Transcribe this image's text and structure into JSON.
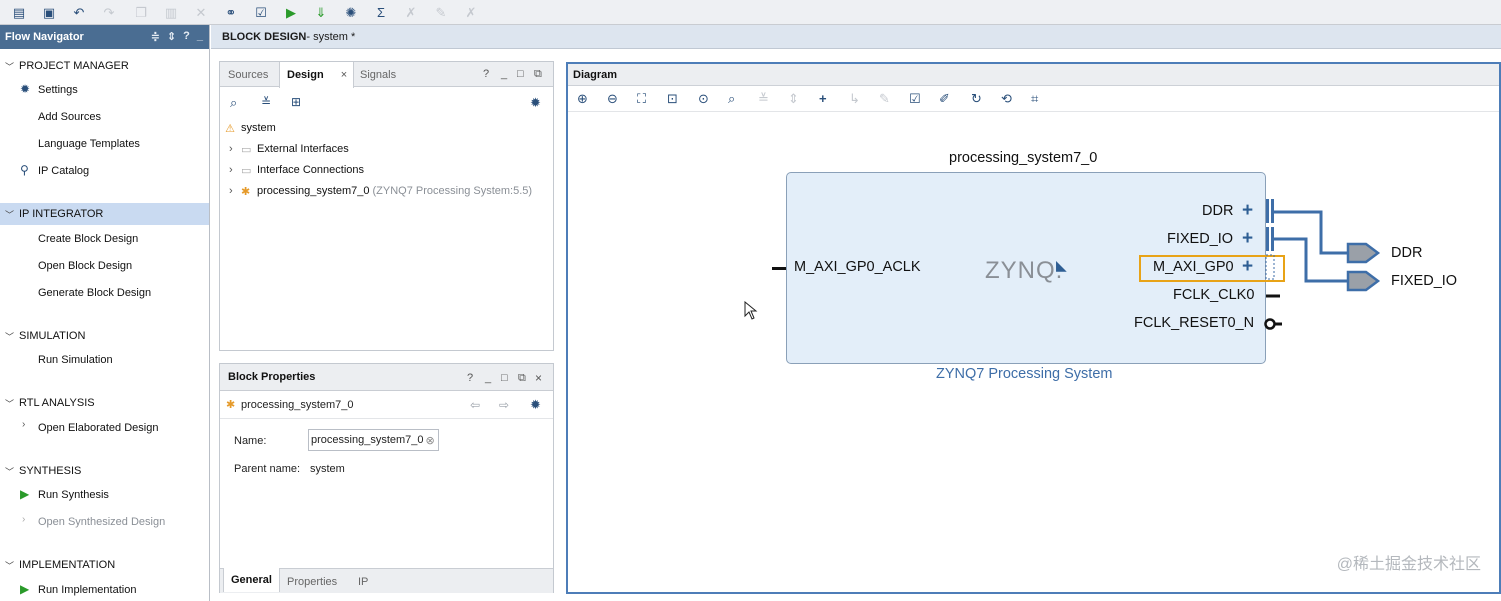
{
  "toolbar": {
    "icons": [
      "open-project-icon",
      "save-icon",
      "undo-icon",
      "redo-icon",
      "copy-icon",
      "paste-icon",
      "delete-icon",
      "find-icon",
      "check-icon",
      "run-icon",
      "program-device-icon",
      "settings-icon",
      "sigma-icon",
      "x1-icon",
      "x2-icon",
      "x3-icon"
    ]
  },
  "flow_navigator": {
    "title": "Flow Navigator",
    "controls": [
      "≑",
      "⇕",
      "?",
      "_"
    ],
    "sections": [
      {
        "title": "PROJECT MANAGER",
        "items": [
          "Settings",
          "Add Sources",
          "Language Templates",
          "IP Catalog"
        ]
      },
      {
        "title": "IP INTEGRATOR",
        "items": [
          "Create Block Design",
          "Open Block Design",
          "Generate Block Design"
        ]
      },
      {
        "title": "SIMULATION",
        "items": [
          "Run Simulation"
        ]
      },
      {
        "title": "RTL ANALYSIS",
        "items": [
          "Open Elaborated Design"
        ]
      },
      {
        "title": "SYNTHESIS",
        "items": [
          "Run Synthesis",
          "Open Synthesized Design"
        ]
      },
      {
        "title": "IMPLEMENTATION",
        "items": [
          "Run Implementation"
        ]
      }
    ]
  },
  "block_design": {
    "title": "BLOCK DESIGN",
    "subtitle": " - system *"
  },
  "sources_panel": {
    "tabs": [
      "Sources",
      "Design",
      "Signals"
    ],
    "close": "×",
    "controls": [
      "?",
      "_",
      "□",
      "⧉"
    ],
    "tree": {
      "root": "system",
      "children": [
        {
          "label": "External Interfaces",
          "detail": ""
        },
        {
          "label": "Interface Connections",
          "detail": ""
        },
        {
          "label": "processing_system7_0",
          "detail": "(ZYNQ7 Processing System:5.5)"
        }
      ]
    }
  },
  "block_properties": {
    "title": "Block Properties",
    "controls": [
      "?",
      "_",
      "□",
      "⧉",
      "×"
    ],
    "selected": "processing_system7_0",
    "name_label": "Name:",
    "name_value": "processing_system7_0",
    "parent_label": "Parent name:",
    "parent_value": "system",
    "tabs": [
      "General",
      "Properties",
      "IP"
    ]
  },
  "diagram": {
    "title": "Diagram",
    "block": {
      "instance_name": "processing_system7_0",
      "caption": "ZYNQ7 Processing System",
      "logo": "ZYNQ.",
      "left_ports": [
        "M_AXI_GP0_ACLK"
      ],
      "right_ports": [
        "DDR",
        "FIXED_IO",
        "M_AXI_GP0",
        "FCLK_CLK0",
        "FCLK_RESET0_N"
      ]
    },
    "external_ports": [
      "DDR",
      "FIXED_IO"
    ],
    "colors": {
      "block_fill": "#e3eef9",
      "wire": "#3e6ea8",
      "highlight": "#e8a317"
    }
  },
  "watermark": "@稀土掘金技术社区"
}
